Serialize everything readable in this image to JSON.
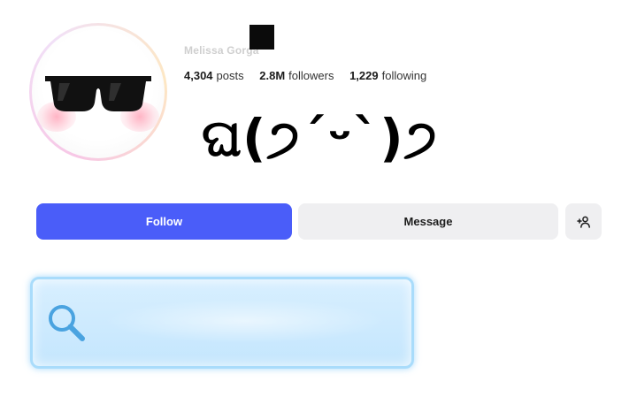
{
  "profile": {
    "username": "Melissa Gorga",
    "avatar_icon": "sunglasses-face-icon",
    "stats": [
      {
        "value": "4,304",
        "label": "posts"
      },
      {
        "value": "2.8M",
        "label": "followers"
      },
      {
        "value": "1,229",
        "label": "following"
      }
    ],
    "bio_kaomoji": "ଘ(੭ˊᵕˋ)੭"
  },
  "actions": {
    "follow_label": "Follow",
    "message_label": "Message",
    "add_user_icon": "add-user-icon"
  },
  "search": {
    "placeholder": "",
    "icon": "search-icon"
  },
  "colors": {
    "follow_button": "#4a5df9",
    "secondary_button": "#efeff1",
    "search_box": "#c4e6fd",
    "search_icon": "#4aa3e0"
  }
}
